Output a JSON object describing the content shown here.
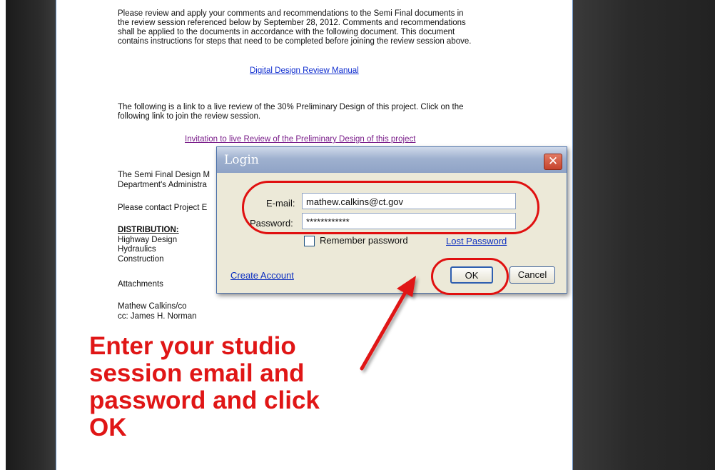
{
  "document": {
    "paragraph_1_lines": [
      "Please review and apply your comments and recommendations to the Semi Final documents in",
      "the review session referenced below by September 28, 2012.  Comments and recommendations",
      "shall be applied to the documents in accordance with the following document.  This document",
      "contains instructions for steps that need to be completed before joining the review session above."
    ],
    "manual_link": "Digital Design Review Manual",
    "paragraph_2_lines": [
      "The following is a link to a live review of the 30% Preliminary Design of this project.  Click on the",
      "following link to join the review session."
    ],
    "invitation_link": "Invitation to live Review of the Preliminary Design of this project",
    "partial_lines": [
      "The Semi Final Design M",
      "Department's Administra"
    ],
    "contact_line": "Please contact Project E",
    "distribution_heading": "DISTRIBUTION:",
    "distribution_items": [
      "Highway Design",
      "Hydraulics",
      "Construction"
    ],
    "attachments": "Attachments",
    "signature": "Mathew Calkins/co",
    "cc": "cc:  James H. Norman"
  },
  "dialog": {
    "title": "Login",
    "close_glyph": "✕",
    "email_label": "E-mail:",
    "email_value": "mathew.calkins@ct.gov",
    "password_label": "Password:",
    "password_value": "************",
    "remember_label": "Remember password",
    "remember_checked": false,
    "lost_password": "Lost Password",
    "create_account": "Create  Account",
    "ok_label": "OK",
    "cancel_label": "Cancel"
  },
  "annotation": {
    "instruction_lines": [
      "Enter your studio",
      "session email and",
      "password and click",
      "OK"
    ],
    "color": "#e01616"
  }
}
